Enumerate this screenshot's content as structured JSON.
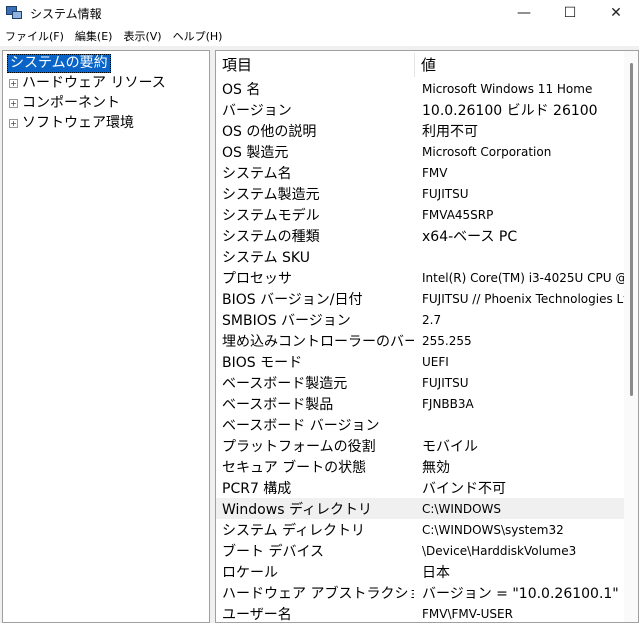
{
  "window": {
    "title": "システム情報",
    "minimize": "—",
    "maximize": "☐",
    "close": "✕"
  },
  "menu": [
    "ファイル(F)",
    "編集(E)",
    "表示(V)",
    "ヘルプ(H)"
  ],
  "tree": {
    "root": "システムの要約",
    "children": [
      "ハードウェア リソース",
      "コンポーネント",
      "ソフトウェア環境"
    ],
    "expander": "+"
  },
  "table": {
    "headers": [
      "項目",
      "値"
    ],
    "rows": [
      {
        "k": "OS 名",
        "v": "Microsoft Windows 11 Home"
      },
      {
        "k": "バージョン",
        "v": "10.0.26100 ビルド 26100"
      },
      {
        "k": "OS の他の説明",
        "v": "利用不可"
      },
      {
        "k": "OS 製造元",
        "v": "Microsoft Corporation"
      },
      {
        "k": "システム名",
        "v": "FMV"
      },
      {
        "k": "システム製造元",
        "v": "FUJITSU"
      },
      {
        "k": "システムモデル",
        "v": "FMVA45SRP"
      },
      {
        "k": "システムの種類",
        "v": "x64-ベース PC"
      },
      {
        "k": "システム SKU",
        "v": ""
      },
      {
        "k": "プロセッサ",
        "v": "Intel(R) Core(TM) i3-4025U CPU @"
      },
      {
        "k": "BIOS バージョン/日付",
        "v": "FUJITSU // Phoenix Technologies Lt"
      },
      {
        "k": "SMBIOS バージョン",
        "v": "2.7"
      },
      {
        "k": "埋め込みコントローラーのバー...",
        "v": "255.255"
      },
      {
        "k": "BIOS モード",
        "v": "UEFI"
      },
      {
        "k": "ベースボード製造元",
        "v": "FUJITSU"
      },
      {
        "k": "ベースボード製品",
        "v": "FJNBB3A"
      },
      {
        "k": "ベースボード バージョン",
        "v": ""
      },
      {
        "k": "プラットフォームの役割",
        "v": "モバイル"
      },
      {
        "k": "セキュア ブートの状態",
        "v": "無効"
      },
      {
        "k": "PCR7 構成",
        "v": "バインド不可"
      },
      {
        "k": "Windows ディレクトリ",
        "v": "C:\\WINDOWS"
      },
      {
        "k": "システム ディレクトリ",
        "v": "C:\\WINDOWS\\system32"
      },
      {
        "k": "ブート デバイス",
        "v": "\\Device\\HarddiskVolume3"
      },
      {
        "k": "ロケール",
        "v": "日本"
      },
      {
        "k": "ハードウェア アブストラクション ...",
        "v": "バージョン = \"10.0.26100.1\""
      },
      {
        "k": "ユーザー名",
        "v": "FMV\\FMV-USER"
      }
    ],
    "selected_row": 20
  }
}
